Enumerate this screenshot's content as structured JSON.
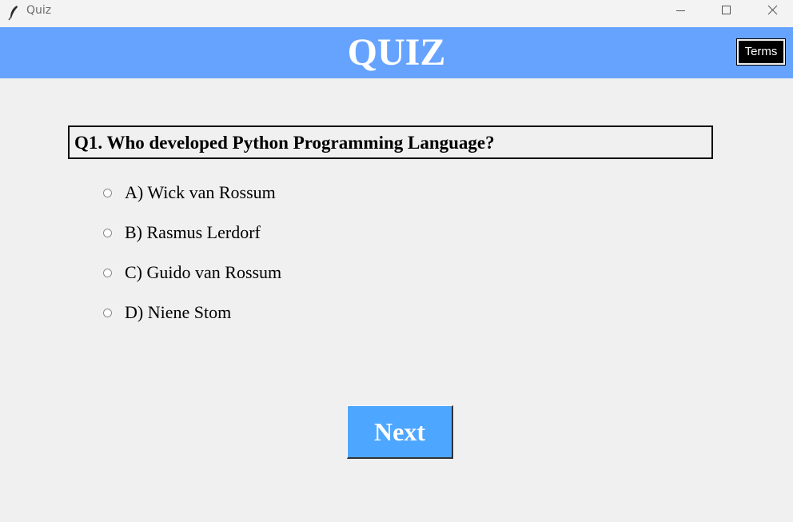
{
  "window": {
    "title": "Quiz",
    "controls": [
      "minimize-icon",
      "maximize-icon",
      "close-icon"
    ]
  },
  "header": {
    "title": "QUIZ",
    "background": "#66a3ff",
    "terms_label": "Terms"
  },
  "question": {
    "text": "Q1. Who developed Python Programming Language?"
  },
  "options": [
    {
      "label": "A) Wick van Rossum",
      "selected": false
    },
    {
      "label": "B) Rasmus Lerdorf",
      "selected": false
    },
    {
      "label": "C) Guido van Rossum",
      "selected": false
    },
    {
      "label": "D) Niene Stom",
      "selected": false
    }
  ],
  "next_button": {
    "label": "Next",
    "background": "#4da6ff"
  }
}
